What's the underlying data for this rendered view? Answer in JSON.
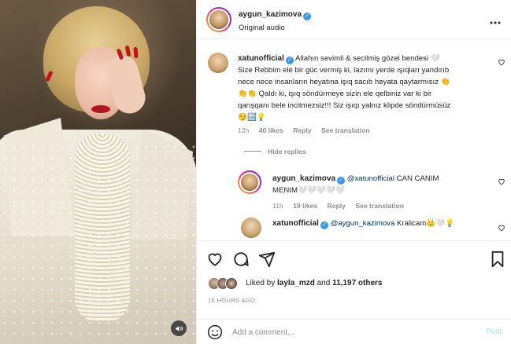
{
  "post": {
    "author": "aygun_kazimova",
    "audio": "Original audio",
    "more_icon": "more-horizontal-icon"
  },
  "comments": {
    "main": {
      "username": "xatunofficial",
      "text_line1": "Allahın sevimli & secilmiş gözel bendesi 🤍",
      "text_line2": "Size Rebbim ele bir güc vermiş ki, lazımı yerde ışıqları yandırıb",
      "text_line3": "nece nece insanların heyatına işıq sacıb heyata qaytarmısız 👏",
      "text_line4": "👏👏 Qaldı ki, işıq söndürmeye sizin ele qelbiniz var ki bir",
      "text_line5": "qarışqanı bele incitmezsiz!!! Siz işıqı yalnız klipde söndürmüsüz",
      "text_line6": "😏🔚💡",
      "time": "12h",
      "likes": "40 likes",
      "reply": "Reply",
      "translate": "See translation"
    },
    "hide_replies": "Hide replies",
    "reply1": {
      "username": "aygun_kazimova",
      "mention": "@xatunofficial",
      "text": "CAN CANIM",
      "text_line2": "MENIM🤍🤍🤍🤍🤍",
      "time": "11h",
      "likes": "19 likes",
      "reply": "Reply",
      "translate": "See translation"
    },
    "reply2": {
      "username": "xatunofficial",
      "mention": "@aygun_kazimova",
      "text": "Kralicam👑🤍💡"
    }
  },
  "actions": {
    "liked_by_prefix": "Liked by",
    "liked_by_user": "layla_mzd",
    "and": "and",
    "others": "11,197 others",
    "time_ago": "16 HOURS AGO"
  },
  "composer": {
    "placeholder": "Add a comment...",
    "post_label": "Post"
  },
  "colors": {
    "link_blue": "#00376b",
    "verified_blue": "#3897f0",
    "muted": "#8e8e8e",
    "post_disabled": "#b2dffc"
  }
}
